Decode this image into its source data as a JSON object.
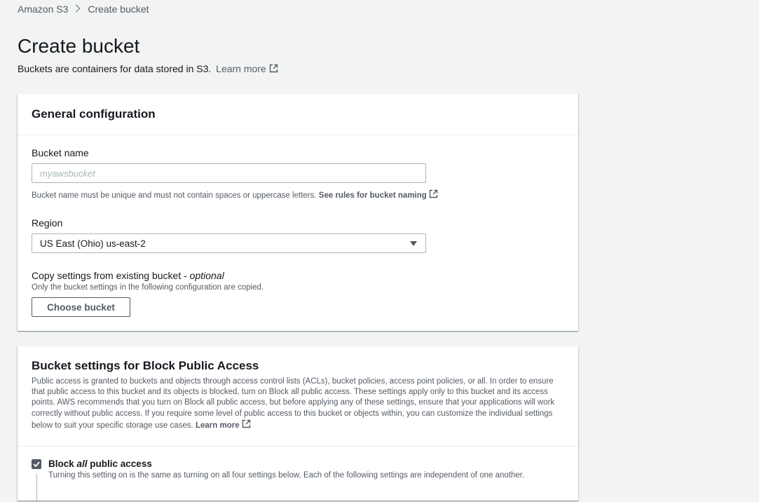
{
  "breadcrumb": {
    "items": [
      "Amazon S3",
      "Create bucket"
    ]
  },
  "header": {
    "title": "Create bucket",
    "description": "Buckets are containers for data stored in S3.",
    "learn_more": "Learn more"
  },
  "general_config": {
    "title": "General configuration",
    "bucket_name": {
      "label": "Bucket name",
      "placeholder": "myawsbucket",
      "value": "",
      "hint": "Bucket name must be unique and must not contain spaces or uppercase letters.",
      "rules_link": "See rules for bucket naming"
    },
    "region": {
      "label": "Region",
      "selected": "US East (Ohio) us-east-2"
    },
    "copy_settings": {
      "label": "Copy settings from existing bucket - ",
      "label_optional": "optional",
      "hint": "Only the bucket settings in the following configuration are copied.",
      "button": "Choose bucket"
    }
  },
  "block_public_access": {
    "title": "Bucket settings for Block Public Access",
    "description": "Public access is granted to buckets and objects through access control lists (ACLs), bucket policies, access point policies, or all. In order to ensure that public access to this bucket and its objects is blocked, turn on Block all public access. These settings apply only to this bucket and its access points. AWS recommends that you turn on Block all public access, but before applying any of these settings, ensure that your applications will work correctly without public access. If you require some level of public access to this bucket or objects within, you can customize the individual settings below to suit your specific storage use cases.",
    "learn_more": "Learn more",
    "block_all": {
      "checked": true,
      "label_prefix": "Block ",
      "label_emphasis": "all",
      "label_suffix": " public access",
      "description": "Turning this setting on is the same as turning on all four settings below. Each of the following settings are independent of one another."
    }
  },
  "icons": {
    "external_link": "external-link-icon",
    "breadcrumb_separator": "chevron-right-icon",
    "dropdown": "caret-down-icon",
    "checkbox": "checkmark-icon"
  },
  "colors": {
    "background": "#f2f3f3",
    "panel": "#ffffff",
    "text": "#16191f",
    "secondary_text": "#545b64",
    "border": "#aab7b8",
    "checkbox_fill": "#545b64"
  }
}
